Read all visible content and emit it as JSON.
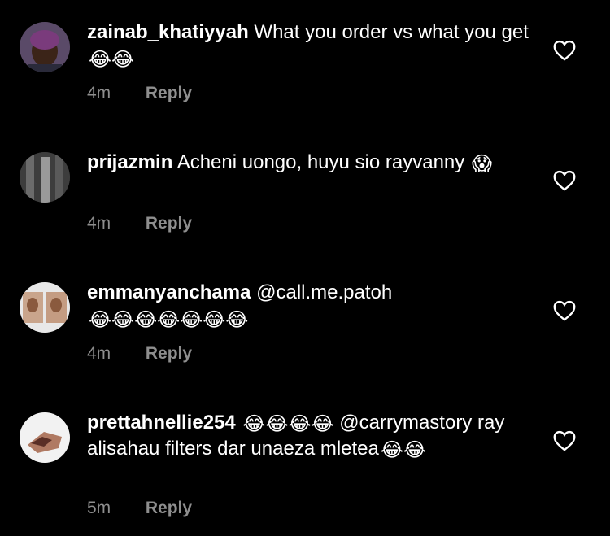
{
  "comments": [
    {
      "username": "zainab_khatiyyah",
      "text": "What you order vs what you get",
      "emojis": "😂😂",
      "time": "4m",
      "reply_label": "Reply"
    },
    {
      "username": "prijazmin",
      "text": "Acheni uongo, huyu sio rayvanny",
      "emojis": "😱",
      "time": "4m",
      "reply_label": "Reply"
    },
    {
      "username": "emmanyanchama",
      "text": "@call.me.patoh",
      "emojis": "😂😂😂😂😂😂😂",
      "time": "4m",
      "reply_label": "Reply"
    },
    {
      "username": "prettahnellie254",
      "text_before": "😂😂😂😂",
      "text": "@carrymastory ray alisahau filters dar unaeza mletea",
      "emojis": "😂😂",
      "time": "5m",
      "reply_label": "Reply"
    }
  ],
  "icons": {
    "like": "heart-outline-icon"
  },
  "colors": {
    "background": "#000000",
    "text": "#ffffff",
    "meta": "#8e8e8e"
  }
}
